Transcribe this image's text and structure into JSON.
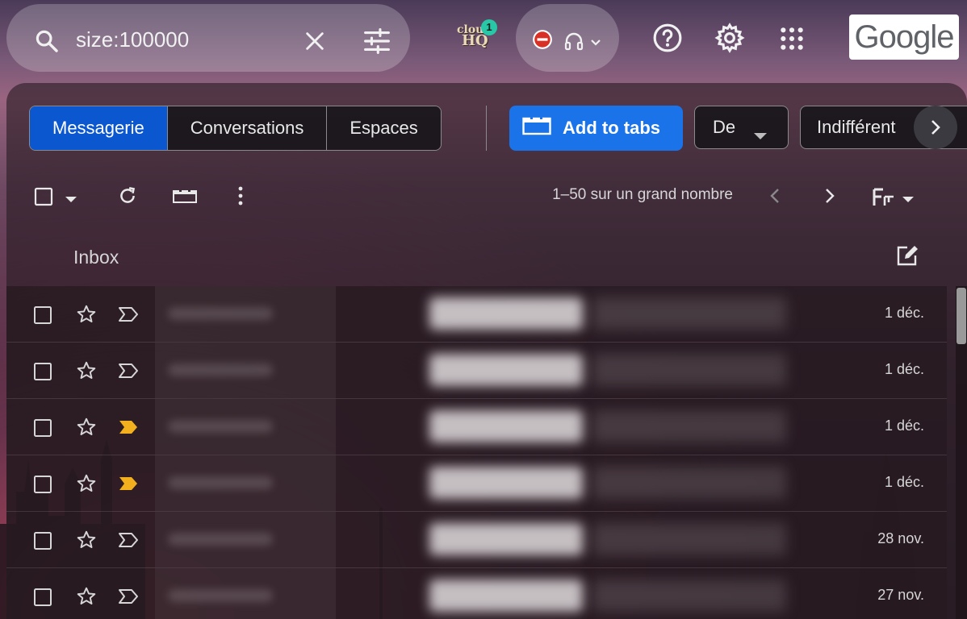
{
  "search": {
    "query": "size:100000"
  },
  "extension": {
    "logo_text_1": "clou",
    "logo_text_2": "HQ",
    "badge_count": "1"
  },
  "brand": {
    "google": "Google"
  },
  "tabs": {
    "items": [
      {
        "label": "Messagerie",
        "active": true
      },
      {
        "label": "Conversations",
        "active": false
      },
      {
        "label": "Espaces",
        "active": false
      }
    ],
    "add_to_tabs": "Add to tabs"
  },
  "filters": {
    "from": "De",
    "any_time": "Indifférent"
  },
  "toolbar": {
    "pagination": "1–50 sur un grand nombre"
  },
  "list": {
    "section_title": "Inbox",
    "emails": [
      {
        "date": "1 déc.",
        "important": false
      },
      {
        "date": "1 déc.",
        "important": false
      },
      {
        "date": "1 déc.",
        "important": true
      },
      {
        "date": "1 déc.",
        "important": true
      },
      {
        "date": "28 nov.",
        "important": false
      },
      {
        "date": "27 nov.",
        "important": false
      }
    ]
  },
  "colors": {
    "primary_blue": "#0b57d0",
    "add_tabs_blue": "#1a73e8",
    "important_marker": "#f2b01e",
    "dnd_red": "#d93025"
  },
  "icons": {
    "search": "search-icon",
    "clear": "close-icon",
    "filters": "tune-icon",
    "dnd": "do-not-disturb-icon",
    "headset": "headset-icon",
    "help": "help-icon",
    "settings": "gear-icon",
    "apps": "apps-grid-icon",
    "compose": "edit-icon"
  }
}
